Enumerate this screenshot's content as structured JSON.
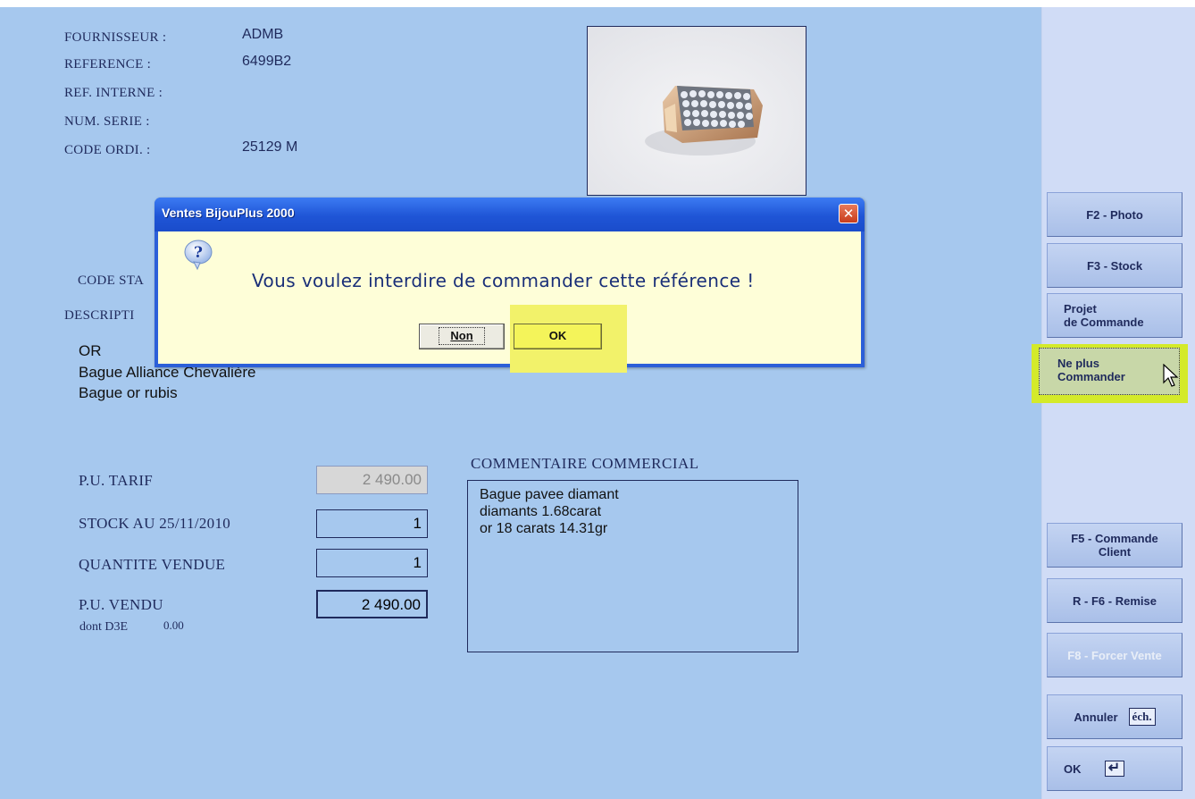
{
  "product": {
    "fields": [
      {
        "label": "FOURNISSEUR :",
        "value": "ADMB"
      },
      {
        "label": "REFERENCE :",
        "value": "6499B2"
      },
      {
        "label": "REF. INTERNE :",
        "value": ""
      },
      {
        "label": "NUM. SERIE :",
        "value": ""
      },
      {
        "label": "CODE ORDI. :",
        "value": "25129 M"
      }
    ],
    "code_stat_label": "CODE STA",
    "description_label": "DESCRIPTI",
    "description_lines": [
      "OR",
      "Bague Alliance Chevalière",
      "Bague or rubis"
    ]
  },
  "pricing": {
    "pu_tarif_label": "P.U. TARIF",
    "pu_tarif_value": "2 490.00",
    "stock_label": "STOCK AU 25/11/2010",
    "stock_value": "1",
    "quantite_label": "QUANTITE   VENDUE",
    "quantite_value": "1",
    "pu_vendu_label": "P.U. VENDU",
    "pu_vendu_value": "2 490.00",
    "d3e_label": "dont D3E",
    "d3e_value": "0.00"
  },
  "comment": {
    "title": "COMMENTAIRE COMMERCIAL",
    "lines": [
      "Bague pavee diamant",
      "diamants 1.68carat",
      "or 18 carats  14.31gr"
    ]
  },
  "sidebar": {
    "photo": "F2 - Photo",
    "stock": "F3 - Stock",
    "projet_line1": "Projet",
    "projet_line2": "de Commande",
    "ne_plus_line1": "Ne plus",
    "ne_plus_line2": "Commander",
    "commande_line1": "F5 - Commande",
    "commande_line2": "Client",
    "remise": "R - F6 - Remise",
    "forcer": "F8 - Forcer Vente",
    "annuler": "Annuler",
    "annuler_key": "éch.",
    "ok": "OK",
    "ok_key": "↵"
  },
  "dialog": {
    "title": "Ventes BijouPlus 2000",
    "close": "✕",
    "icon": "question-icon",
    "message": "Vous voulez interdire de commander cette référence !",
    "button_non": "Non",
    "button_ok": "OK"
  },
  "colors": {
    "background": "#a6c8ee",
    "sidebar": "#d0dcf6",
    "highlight": "#d4ea2a",
    "dialog_body": "#fefed8",
    "titlebar": "#1f55d6"
  }
}
